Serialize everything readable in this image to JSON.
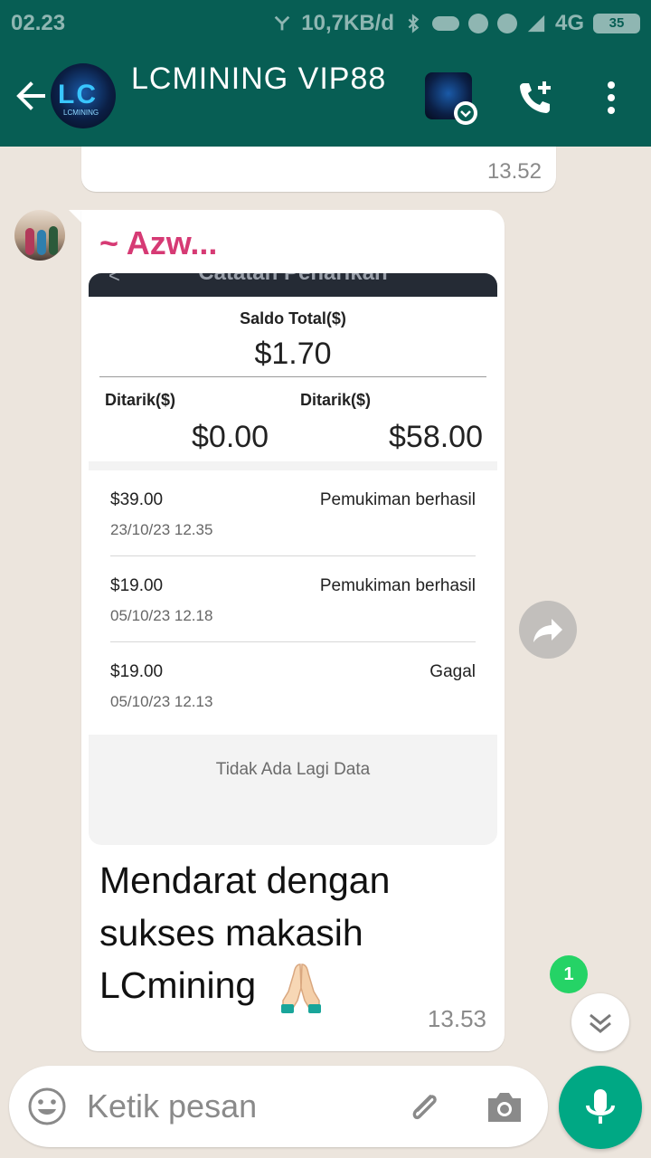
{
  "status_bar": {
    "time": "02.23",
    "network_speed": "10,7KB/d",
    "network_type": "4G",
    "battery": "35"
  },
  "header": {
    "title": "LCMINING VIP88",
    "group_avatar_text": "LC",
    "group_avatar_sub": "LCMINING",
    "background_color": "#075e54"
  },
  "chat": {
    "previous_message_time": "13.52",
    "message": {
      "sender_name": "~ Azw...",
      "sender_color": "#d63a74",
      "screenshot": {
        "header_title": "Catatan Penarikan",
        "saldo_label": "Saldo Total($)",
        "saldo_value": "$1.70",
        "ditarik_label_1": "Ditarik($)",
        "ditarik_value_1": "$0.00",
        "ditarik_label_2": "Ditarik($)",
        "ditarik_value_2": "$58.00",
        "records": [
          {
            "amount": "$39.00",
            "status": "Pemukiman berhasil",
            "date": "23/10/23 12.35"
          },
          {
            "amount": "$19.00",
            "status": "Pemukiman berhasil",
            "date": "05/10/23 12.18"
          },
          {
            "amount": "$19.00",
            "status": "Gagal",
            "date": "05/10/23 12.13"
          }
        ],
        "no_more_data": "Tidak Ada Lagi Data"
      },
      "caption": "Mendarat dengan sukses makasih LCmining",
      "emoji": "folded-hands",
      "time": "13.53"
    },
    "unread_count": "1"
  },
  "input": {
    "placeholder": "Ketik pesan"
  },
  "colors": {
    "accent": "#00a884",
    "unread_badge": "#25d366",
    "chat_background": "#ece5dd"
  }
}
